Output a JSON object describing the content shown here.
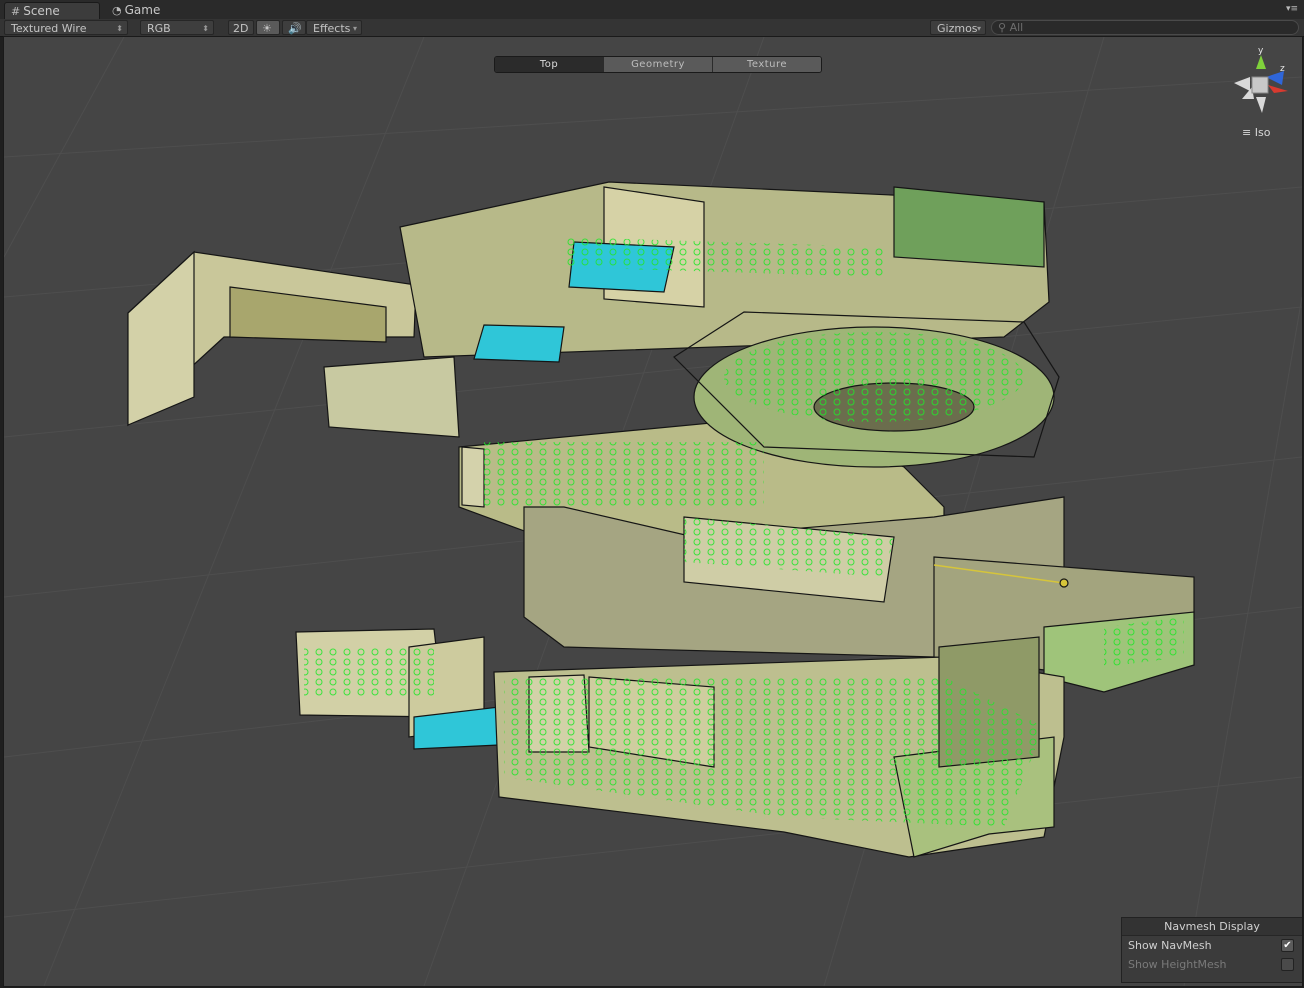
{
  "tabs": [
    {
      "label": "Scene",
      "icon": "grid-icon",
      "active": true
    },
    {
      "label": "Game",
      "icon": "pacman-icon",
      "active": false
    }
  ],
  "toolbar": {
    "render_mode": "Textured Wire",
    "color_mode": "RGB",
    "mode_2d": "2D",
    "lighting_icon": "sun-icon",
    "audio_icon": "speaker-icon",
    "effects": "Effects",
    "gizmos": "Gizmos",
    "search_placeholder": "All"
  },
  "view_tabs": [
    {
      "label": "Top",
      "active": true
    },
    {
      "label": "Geometry",
      "active": false
    },
    {
      "label": "Texture",
      "active": false
    }
  ],
  "orientation": {
    "y_axis": "y",
    "z_axis": "z",
    "projection": "Iso"
  },
  "navmesh_display": {
    "title": "Navmesh Display",
    "show_navmesh": {
      "label": "Show NavMesh",
      "checked": true
    },
    "show_heightmesh": {
      "label": "Show HeightMesh",
      "checked": false,
      "enabled": false
    }
  },
  "colors": {
    "viewport_bg": "#454545",
    "navmesh": "#22e62a",
    "water": "#2fc6d8",
    "wall": "#d8d6a8"
  }
}
